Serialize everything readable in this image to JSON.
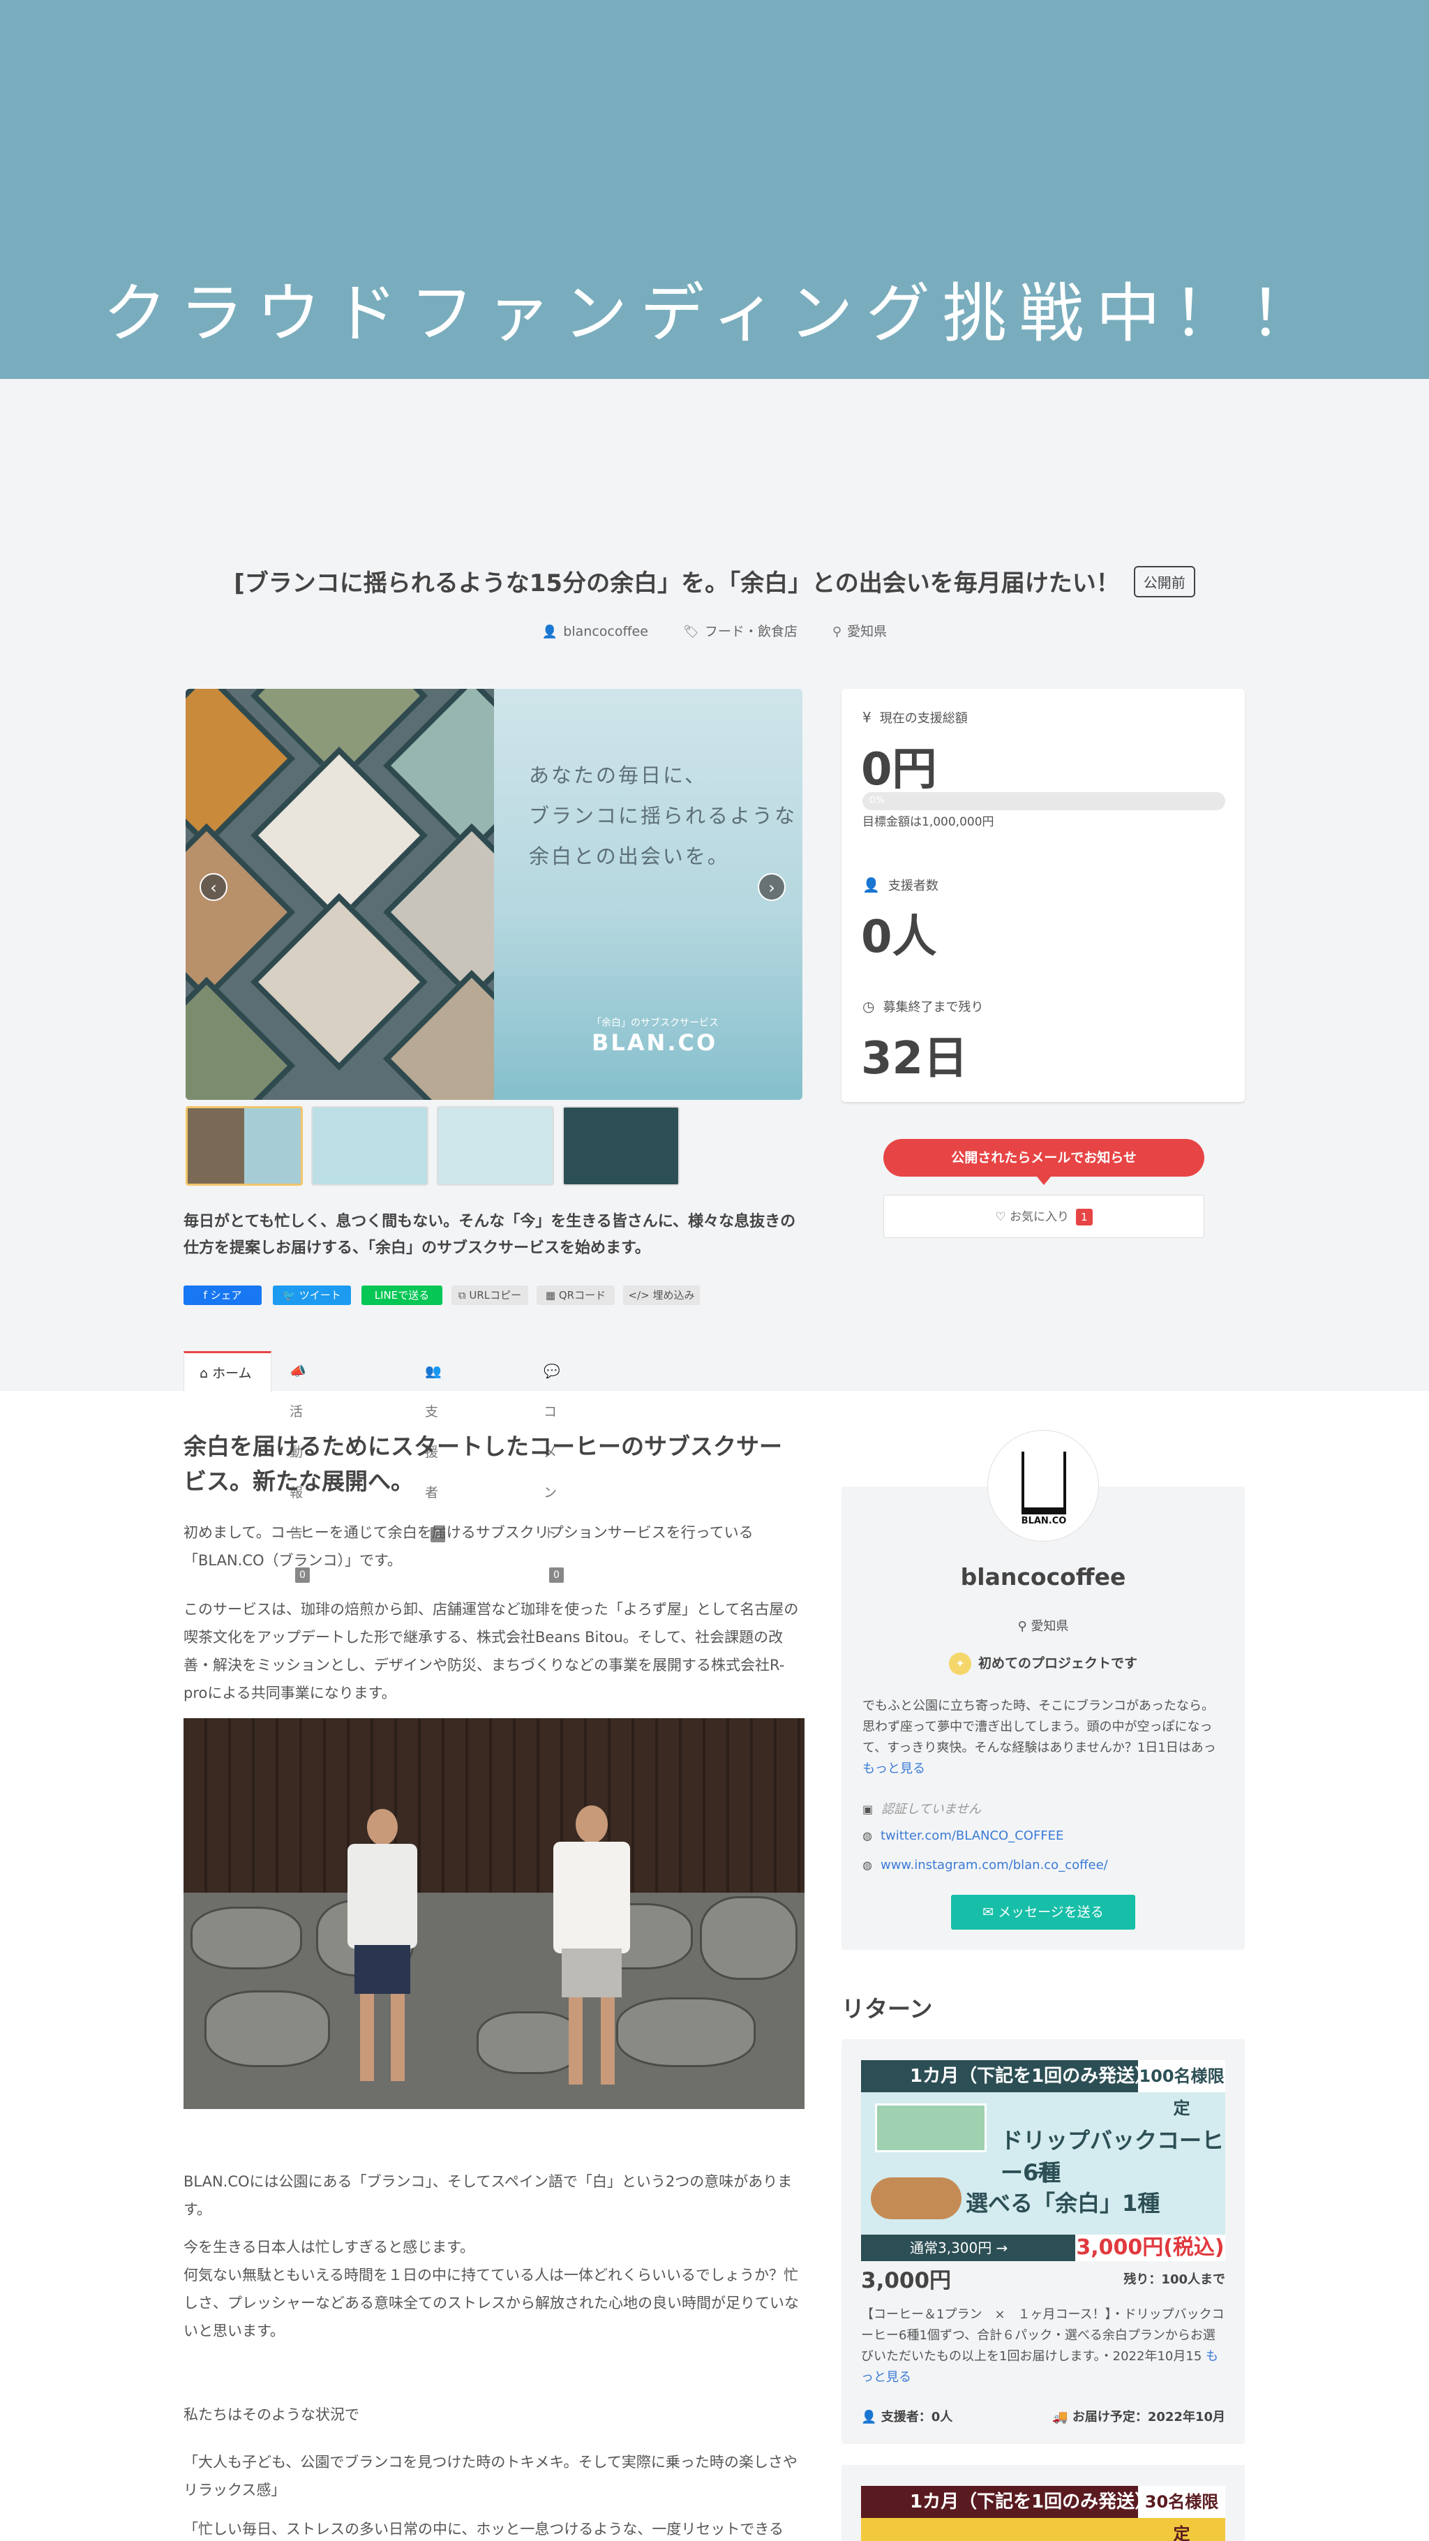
{
  "hero": {
    "title": "クラウドファンディング挑戦中！！"
  },
  "project": {
    "title": "[ブランコに揺られるような15分の余白」を。「余白」との出会いを毎月届けたい！",
    "status": "公開前",
    "owner": "blancocoffee",
    "category": "フード・飲食店",
    "location": "愛知県"
  },
  "gallery": {
    "copy_line1": "あなたの毎日に、",
    "copy_line2": "ブランコに揺られるような",
    "copy_line3": "余白との出会いを。",
    "brand_sub": "「余白」のサブスクサービス",
    "brand": "BLAN.CO",
    "prev": "‹",
    "next": "›"
  },
  "lead": "毎日がとても忙しく、息つく間もない。そんな「今」を生きる皆さんに、様々な息抜きの仕方を提案しお届けする、「余白」のサブスクサービスを始めます。",
  "share": {
    "facebook": "シェア",
    "twitter": "ツイート",
    "line": "LINEで送る",
    "url": "URLコピー",
    "qr": "QRコード",
    "embed": "埋め込み"
  },
  "stats": {
    "total_label": "現在の支援総額",
    "total_value": "0円",
    "progress_percent": 0,
    "progress_text": "0%",
    "goal": "目標金額は1,000,000円",
    "supporters_label": "支援者数",
    "supporters_value": "0人",
    "remaining_label": "募集終了まで残り",
    "remaining_value": "32日"
  },
  "actions": {
    "notify": "公開されたらメールでお知らせ",
    "favorite": "お気に入り",
    "favorite_count": "1"
  },
  "tabs": [
    {
      "label": "ホーム"
    },
    {
      "label": "活動報告",
      "count": "0"
    },
    {
      "label": "支援者",
      "count": "0"
    },
    {
      "label": "コメント",
      "count": "0"
    }
  ],
  "article": {
    "heading": "余白を届けるためにスタートしたコーヒーのサブスクサービス。新たな展開へ。",
    "p1": "初めまして。コーヒーを通じて余白を届けるサブスクリプションサービスを行っている「BLAN.CO（ブランコ）」です。",
    "p2": "このサービスは、珈琲の焙煎から卸、店舗運営など珈琲を使った「よろず屋」として名古屋の喫茶文化をアップデートした形で継承する、株式会社Beans Bitou。そして、社会課題の改善・解決をミッションとし、デザインや防災、まちづくりなどの事業を展開する株式会社R-proによる共同事業になります。",
    "p3": "BLAN.COには公園にある「ブランコ」、そしてスペイン語で「白」という2つの意味があります。",
    "p4": "今を生きる日本人は忙しすぎると感じます。",
    "p5": "何気ない無駄ともいえる時間を１日の中に持てている人は一体どれくらいいるでしょうか？忙しさ、プレッシャーなどある意味全てのストレスから解放された心地の良い時間が足りていないと思います。",
    "p6": "私たちはそのような状況で",
    "p7": "「大人も子ども、公園でブランコを見つけた時のトキメキ。そして実際に乗った時の楽しさやリラックス感」",
    "p8": "「忙しい毎日、ストレスの多い日常の中に、ホッと一息つけるような、一度リセットできる"
  },
  "profile": {
    "avatar_text": "BLAN.CO",
    "name": "blancocoffee",
    "location": "愛知県",
    "first_project": "初めてのプロジェクトです",
    "desc": "でもふと公園に立ち寄った時、そこにブランコがあったなら。思わず座って夢中で漕ぎ出してしまう。頭の中が空っぽになって、すっきり爽快。そんな経験はありませんか？1日1日はあっ",
    "more": "もっと見る",
    "twitter_unverified": "認証していません",
    "twitter": "twitter.com/BLANCO_COFFEE",
    "instagram": "www.instagram.com/blan.co_coffee/",
    "message": "メッセージを送る"
  },
  "returns": {
    "heading": "リターン",
    "items": [
      {
        "band": "1カ月（下記を1回のみ発送）",
        "limit": "100名様限定",
        "line1": "ドリップバックコーヒー6種",
        "plus": "＋",
        "line2": "選べる「余白」1種",
        "regular": "通常3,300円 →",
        "special": "3,000円(税込)",
        "price": "3,000円",
        "remaining": "残り：100人まで",
        "desc": "【コーヒー＆1プラン　×　１ヶ月コース！】・ドリップバックコーヒー6種1個ずつ、合計６パック・選べる余白プランからお選びいただいたもの以上を1回お届けします。・2022年10月15",
        "more": "もっと見る",
        "supporters": "支援者：0人",
        "delivery": "お届け予定：2022年10月"
      },
      {
        "band": "1カ月（下記を1回のみ発送）",
        "limit": "30名様限定"
      }
    ]
  },
  "colors": {
    "hero": "#79adbd",
    "accent": "#e74545",
    "teal": "#18bfa8",
    "link": "#3a7bd5"
  }
}
